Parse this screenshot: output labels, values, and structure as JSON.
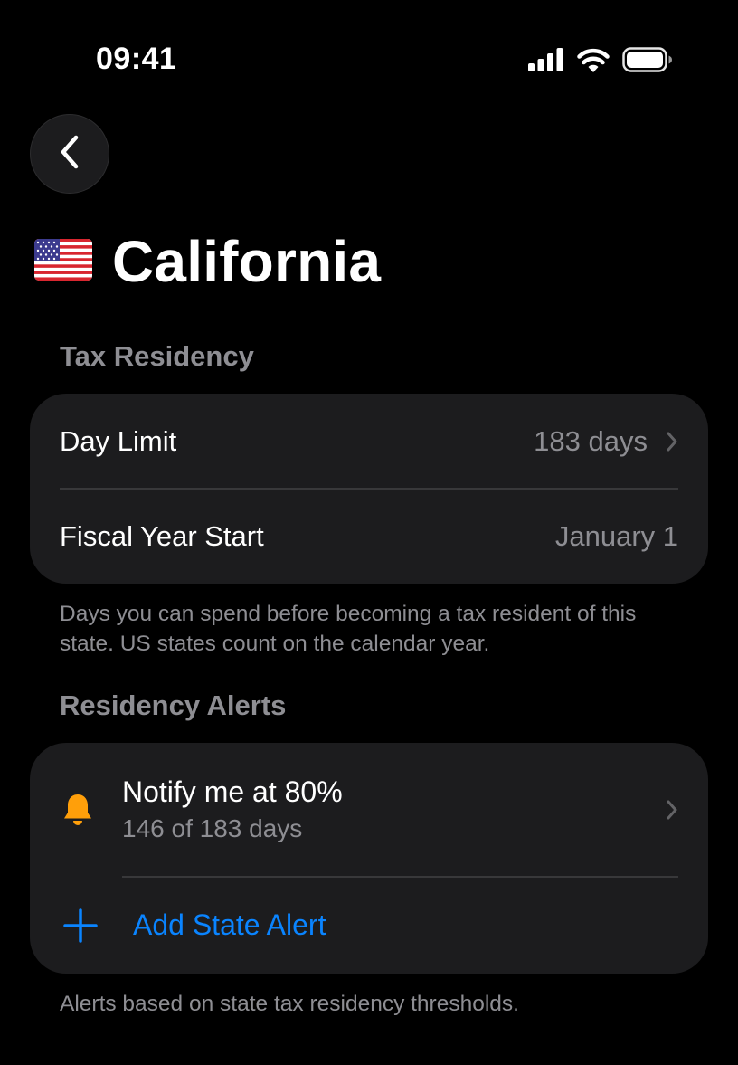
{
  "status_bar": {
    "time": "09:41",
    "icons": [
      "cellular-signal-icon",
      "wifi-icon",
      "battery-icon"
    ]
  },
  "header": {
    "back_icon": "chevron-left-icon",
    "flag_icon": "us-flag-icon",
    "title": "California"
  },
  "tax_residency": {
    "section_title": "Tax Residency",
    "rows": [
      {
        "label": "Day Limit",
        "value": "183 days",
        "has_chevron": true
      },
      {
        "label": "Fiscal Year Start",
        "value": "January 1",
        "has_chevron": false
      }
    ],
    "footnote": "Days you can spend before becoming a tax resident of this state. US states count on the calendar year."
  },
  "residency_alerts": {
    "section_title": "Residency Alerts",
    "alert": {
      "icon": "bell-icon",
      "title": "Notify me at 80%",
      "subtitle": "146 of 183 days"
    },
    "add_button": {
      "icon": "plus-icon",
      "label": "Add State Alert"
    },
    "footnote": "Alerts based on state tax residency thresholds."
  },
  "colors": {
    "background": "#000000",
    "card": "#1c1c1e",
    "secondary_text": "#8e8e93",
    "accent_blue": "#0a84ff",
    "bell_orange": "#ff9f0a"
  }
}
